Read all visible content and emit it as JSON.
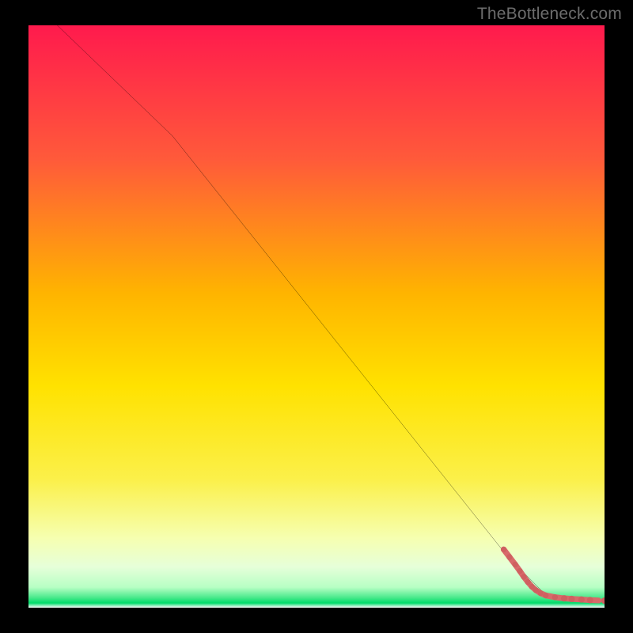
{
  "watermark": "TheBottleneck.com",
  "chart_data": {
    "type": "line",
    "title": "",
    "xlabel": "",
    "ylabel": "",
    "x_range": [
      0,
      100
    ],
    "y_range": [
      0,
      100
    ],
    "background": {
      "type": "vertical_gradient",
      "bands": [
        {
          "y": 100,
          "color": "#ff1a4d"
        },
        {
          "y": 75,
          "color": "#ff6a2a"
        },
        {
          "y": 50,
          "color": "#ffd400"
        },
        {
          "y": 25,
          "color": "#f8f26a"
        },
        {
          "y": 7,
          "color": "#d6ffcf"
        },
        {
          "y": 1,
          "color": "#00e070"
        },
        {
          "y": 0,
          "color": "#ffffff"
        }
      ]
    },
    "series": [
      {
        "name": "curve",
        "stroke": "#000000",
        "points": [
          {
            "x": 5,
            "y": 100
          },
          {
            "x": 25,
            "y": 81
          },
          {
            "x": 83,
            "y": 9
          },
          {
            "x": 90,
            "y": 2
          },
          {
            "x": 100,
            "y": 1
          }
        ]
      }
    ],
    "markers": {
      "name": "bottom_cluster",
      "stroke": "#d86a6a",
      "fill": "#cf6060",
      "points": [
        {
          "x": 82.5,
          "y": 10.0
        },
        {
          "x": 83.5,
          "y": 8.7
        },
        {
          "x": 84.5,
          "y": 7.4
        },
        {
          "x": 85.3,
          "y": 6.3
        },
        {
          "x": 86.0,
          "y": 5.3
        },
        {
          "x": 86.7,
          "y": 4.4
        },
        {
          "x": 87.4,
          "y": 3.6
        },
        {
          "x": 88.1,
          "y": 3.0
        },
        {
          "x": 88.9,
          "y": 2.5
        },
        {
          "x": 89.8,
          "y": 2.1
        },
        {
          "x": 91.4,
          "y": 1.8
        },
        {
          "x": 93.0,
          "y": 1.6
        },
        {
          "x": 94.3,
          "y": 1.5
        },
        {
          "x": 96.0,
          "y": 1.4
        },
        {
          "x": 97.5,
          "y": 1.3
        },
        {
          "x": 100.0,
          "y": 1.2
        }
      ]
    }
  }
}
